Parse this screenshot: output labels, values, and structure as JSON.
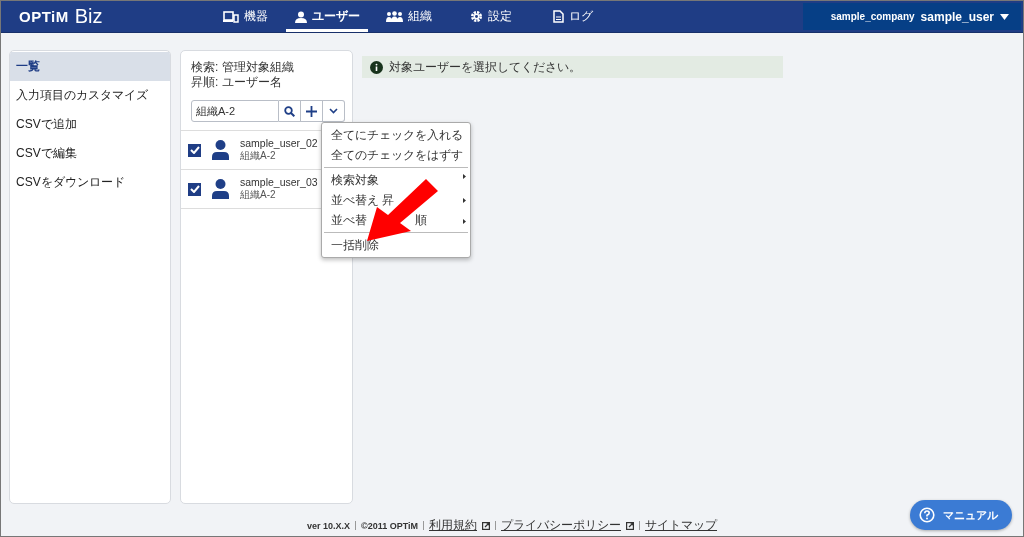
{
  "header": {
    "logo_main": "OPTiM",
    "logo_sub": "Biz",
    "tabs": [
      {
        "label": "機器",
        "selected": false
      },
      {
        "label": "ユーザー",
        "selected": true
      },
      {
        "label": "組織",
        "selected": false
      },
      {
        "label": "設定",
        "selected": false
      },
      {
        "label": "ログ",
        "selected": false
      }
    ],
    "company": "sample_company",
    "user": "sample_user"
  },
  "sidebar": {
    "items": [
      {
        "label": "一覧",
        "selected": true
      },
      {
        "label": "入力項目のカスタマイズ",
        "selected": false
      },
      {
        "label": "CSVで追加",
        "selected": false
      },
      {
        "label": "CSVで編集",
        "selected": false
      },
      {
        "label": "CSVをダウンロード",
        "selected": false
      }
    ]
  },
  "user_list": {
    "search_line": "検索: 管理対象組織",
    "sort_line": "昇順: ユーザー名",
    "search_value": "組織A-2",
    "users": [
      {
        "name": "sample_user_02",
        "org": "組織A-2",
        "checked": true
      },
      {
        "name": "sample_user_03",
        "org": "組織A-2",
        "checked": true
      }
    ]
  },
  "menu": {
    "items": [
      {
        "label": "全てにチェックを入れる",
        "submenu": false,
        "divider_before": false
      },
      {
        "label": "全てのチェックをはずす",
        "submenu": false,
        "divider_before": false
      },
      {
        "label": "検索対象",
        "submenu": true,
        "divider_before": true
      },
      {
        "label": "並べ替え 昇",
        "submenu": true,
        "divider_before": false
      },
      {
        "label": "並べ替",
        "label_end": "順",
        "submenu": true,
        "divider_before": false
      },
      {
        "label": "一括削除",
        "submenu": false,
        "divider_before": true
      }
    ]
  },
  "info": {
    "message": "対象ユーザーを選択してください。"
  },
  "footer": {
    "items": [
      {
        "label": "ver 10.X.X",
        "kind": "text"
      },
      {
        "label": "©2011 OPTiM",
        "kind": "text"
      },
      {
        "label": "利用規約",
        "kind": "external_link"
      },
      {
        "label": "プライバシーポリシー",
        "kind": "external_link"
      },
      {
        "label": "サイトマップ",
        "kind": "link"
      }
    ]
  },
  "manual_button": {
    "label": "マニュアル"
  }
}
